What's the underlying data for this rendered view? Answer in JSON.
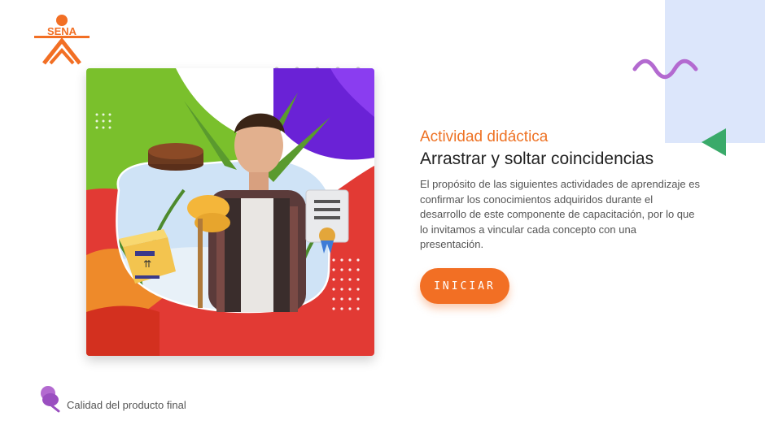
{
  "brand": {
    "logo_text": "SENA",
    "logo_color": "#f26f24"
  },
  "activity": {
    "kicker": "Actividad didáctica",
    "title": "Arrastrar y soltar coincidencias",
    "description": "El propósito de las siguientes actividades de aprendizaje es confirmar los conocimientos adquiridos durante el desarrollo de este componente de capacitación, por lo que lo invitamos a vincular cada concepto con una presentación."
  },
  "actions": {
    "start_label": "INICIAR"
  },
  "footer": {
    "label": "Calidad del producto final",
    "icon": "pin-icon"
  },
  "colors": {
    "accent_orange": "#f26f24",
    "purple": "#b36ad0",
    "green": "#3aaa6a",
    "light_blue": "#dce6fb",
    "hero_green": "#7ac02c",
    "hero_purple": "#6a22d6",
    "hero_red": "#e23a34",
    "hero_orange": "#ee8a2a"
  },
  "icons": [
    "sena-logo",
    "squiggle-decoration",
    "triangle-decoration",
    "box-icon",
    "certificate-icon",
    "cake-icon",
    "pin-icon"
  ]
}
